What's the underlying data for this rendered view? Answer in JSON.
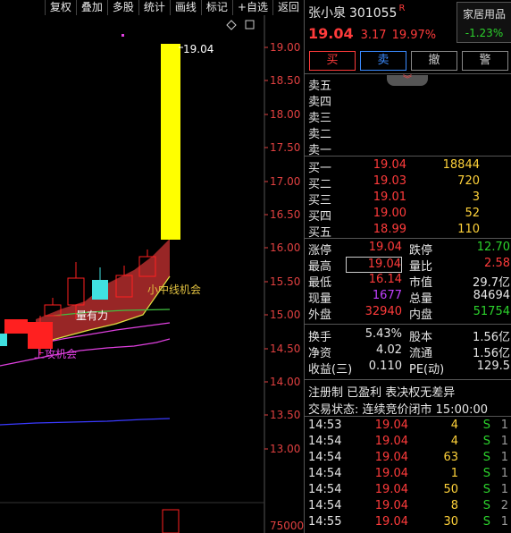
{
  "toolbar": {
    "items": [
      "复权",
      "叠加",
      "多股",
      "统计",
      "画线",
      "标记",
      "+自选",
      "返回"
    ]
  },
  "chart": {
    "price_axis": [
      "19.00",
      "18.50",
      "18.00",
      "17.50",
      "17.00",
      "16.50",
      "16.00",
      "15.50",
      "15.00",
      "14.50",
      "14.00",
      "13.50",
      "13.00"
    ],
    "volume_axis_label": "75000",
    "high_label": "19.04",
    "annotations": [
      "小中线机会",
      "量有力",
      "上攻机会"
    ],
    "colors": {
      "up": "#ff2020",
      "down": "#40e0e0",
      "limit_up": "#ffff00",
      "band": "#a82a2a",
      "ma_green": "#40c040",
      "ma_magenta": "#e040e0",
      "ma_yellow": "#e0e040",
      "ma_blue": "#3030ff"
    }
  },
  "stock": {
    "name": "张小泉",
    "code": "301055",
    "badge": "R",
    "price": "19.04",
    "change": "3.17",
    "change_pct": "19.97%",
    "sector": "家居用品",
    "sector_change": "-1.23%"
  },
  "trade_buttons": [
    "买",
    "卖",
    "撤",
    "警"
  ],
  "asks": [
    {
      "label": "卖五",
      "price": "",
      "vol": ""
    },
    {
      "label": "卖四",
      "price": "",
      "vol": ""
    },
    {
      "label": "卖三",
      "price": "",
      "vol": ""
    },
    {
      "label": "卖二",
      "price": "",
      "vol": ""
    },
    {
      "label": "卖一",
      "price": "",
      "vol": ""
    }
  ],
  "bids": [
    {
      "label": "买一",
      "price": "19.04",
      "vol": "18844"
    },
    {
      "label": "买二",
      "price": "19.03",
      "vol": "720"
    },
    {
      "label": "买三",
      "price": "19.01",
      "vol": "3"
    },
    {
      "label": "买四",
      "price": "19.00",
      "vol": "52"
    },
    {
      "label": "买五",
      "price": "18.99",
      "vol": "110"
    }
  ],
  "stats1": [
    {
      "k1": "涨停",
      "v1": "19.04",
      "c1": "#ff3b3b",
      "k2": "跌停",
      "v2": "12.70",
      "c2": "#2cd32c"
    },
    {
      "k1": "最高",
      "v1": "19.04",
      "c1": "#ff3b3b",
      "k2": "量比",
      "v2": "2.58",
      "c2": "#ff3b3b"
    },
    {
      "k1": "最低",
      "v1": "16.14",
      "c1": "#ff3b3b",
      "k2": "市值",
      "v2": "29.7亿",
      "c2": "#e6e6e6"
    },
    {
      "k1": "现量",
      "v1": "1677",
      "c1": "#c040ff",
      "k2": "总量",
      "v2": "84694",
      "c2": "#e6e6e6"
    },
    {
      "k1": "外盘",
      "v1": "32940",
      "c1": "#ff3b3b",
      "k2": "内盘",
      "v2": "51754",
      "c2": "#2cd32c"
    }
  ],
  "stats2": [
    {
      "k1": "换手",
      "v1": "5.43%",
      "c1": "#e6e6e6",
      "k2": "股本",
      "v2": "1.56亿",
      "c2": "#e6e6e6"
    },
    {
      "k1": "净资",
      "v1": "4.02",
      "c1": "#e6e6e6",
      "k2": "流通",
      "v2": "1.56亿",
      "c2": "#e6e6e6"
    },
    {
      "k1": "收益(三)",
      "v1": "0.110",
      "c1": "#e6e6e6",
      "k2": "PE(动)",
      "v2": "129.5",
      "c2": "#e6e6e6"
    }
  ],
  "info": {
    "line1": "注册制 已盈利 表决权无差异",
    "line2": "交易状态: 连续竞价闭市 15:00:00"
  },
  "ticks": [
    {
      "time": "14:53",
      "price": "19.04",
      "vol": "4",
      "side": "S",
      "cnt": "1"
    },
    {
      "time": "14:54",
      "price": "19.04",
      "vol": "4",
      "side": "S",
      "cnt": "1"
    },
    {
      "time": "14:54",
      "price": "19.04",
      "vol": "63",
      "side": "S",
      "cnt": "1"
    },
    {
      "time": "14:54",
      "price": "19.04",
      "vol": "1",
      "side": "S",
      "cnt": "1"
    },
    {
      "time": "14:54",
      "price": "19.04",
      "vol": "50",
      "side": "S",
      "cnt": "1"
    },
    {
      "time": "14:54",
      "price": "19.04",
      "vol": "8",
      "side": "S",
      "cnt": "2"
    },
    {
      "time": "14:55",
      "price": "19.04",
      "vol": "30",
      "side": "S",
      "cnt": "1"
    }
  ]
}
